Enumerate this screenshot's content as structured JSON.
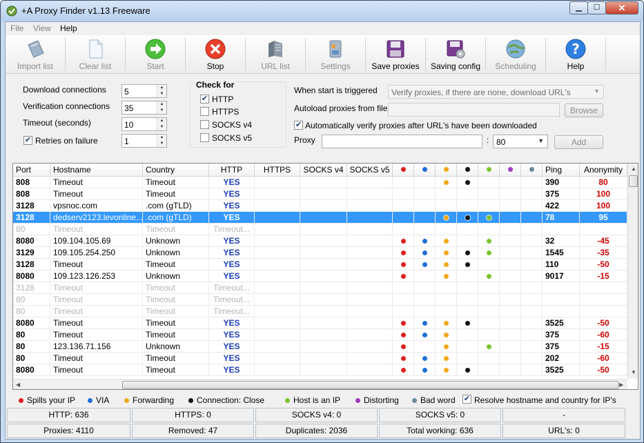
{
  "window": {
    "title": "+A Proxy Finder v1.13 Freeware"
  },
  "menu": [
    "File",
    "View",
    "Help"
  ],
  "toolbar": [
    {
      "label": "Import list",
      "icon": "import-list-icon",
      "enabled": false
    },
    {
      "label": "Clear list",
      "icon": "clear-list-icon",
      "enabled": false
    },
    {
      "label": "Start",
      "icon": "start-icon",
      "enabled": false
    },
    {
      "label": "Stop",
      "icon": "stop-icon",
      "enabled": true
    },
    {
      "label": "URL list",
      "icon": "url-list-icon",
      "enabled": false
    },
    {
      "label": "Settings",
      "icon": "settings-icon",
      "enabled": false
    },
    {
      "label": "Save proxies",
      "icon": "save-proxies-icon",
      "enabled": true
    },
    {
      "label": "Saving config",
      "icon": "saving-config-icon",
      "enabled": true
    },
    {
      "label": "Scheduling",
      "icon": "scheduling-icon",
      "enabled": false
    },
    {
      "label": "Help",
      "icon": "help-icon",
      "enabled": true
    }
  ],
  "options": {
    "download_label": "Download connections",
    "download_value": "5",
    "verify_label": "Verification connections",
    "verify_value": "35",
    "timeout_label": "Timeout (seconds)",
    "timeout_value": "10",
    "retries_label": "Retries on failure",
    "retries_value": "1",
    "retries_checked": true,
    "check_for_title": "Check for",
    "check_http": "HTTP",
    "check_https": "HTTPS",
    "check_socks4": "SOCKS v4",
    "check_socks5": "SOCKS v5",
    "trigger_label": "When start is triggered",
    "trigger_value": "Verify proxies, if there are none, download URL's",
    "autoload_label": "Autoload proxies from file",
    "browse_label": "Browse",
    "auto_verify_label": "Automatically verify proxies after URL's have been downloaded",
    "proxy_label": "Proxy",
    "port_sep": ":",
    "port_value": "80",
    "add_label": "Add"
  },
  "grid": {
    "headers": [
      "Port",
      "Hostname",
      "Country",
      "HTTP",
      "HTTPS",
      "SOCKS v4",
      "SOCKS v5",
      "",
      "",
      "",
      "",
      "",
      "",
      "",
      "Ping",
      "Anonymity"
    ],
    "flag_colors": [
      "#e02020",
      "#1e6fd9",
      "#f0a818",
      "#111111",
      "#7cc22c",
      "#a23ac0",
      "#6a8a99"
    ],
    "rows": [
      {
        "port": "808",
        "host": "Timeout",
        "country": "Timeout",
        "http": "YES",
        "flags": [
          0,
          0,
          1,
          1,
          0,
          0,
          0
        ],
        "ping": "390",
        "anon": "80",
        "style": "normal"
      },
      {
        "port": "808",
        "host": "Timeout",
        "country": "Timeout",
        "http": "YES",
        "flags": [
          0,
          0,
          0,
          0,
          0,
          0,
          0
        ],
        "ping": "375",
        "anon": "100",
        "style": "normal"
      },
      {
        "port": "3128",
        "host": "vpsnoc.com",
        "country": ".com (gTLD)",
        "http": "YES",
        "flags": [
          0,
          0,
          0,
          0,
          0,
          0,
          0
        ],
        "ping": "422",
        "anon": "100",
        "style": "normal"
      },
      {
        "port": "3128",
        "host": "dedserv2123.levonline...",
        "country": ".com (gTLD)",
        "http": "YES",
        "flags": [
          0,
          0,
          1,
          1,
          1,
          0,
          0
        ],
        "ping": "78",
        "anon": "95",
        "style": "sel"
      },
      {
        "port": "80",
        "host": "Timeout",
        "country": "Timeout",
        "http": "Timeout...",
        "flags": [
          0,
          0,
          0,
          0,
          0,
          0,
          0
        ],
        "ping": "",
        "anon": "",
        "style": "gray"
      },
      {
        "port": "8080",
        "host": "109.104.105.69",
        "country": "Unknown",
        "http": "YES",
        "flags": [
          1,
          1,
          1,
          0,
          1,
          0,
          0
        ],
        "ping": "32",
        "anon": "-45",
        "style": "normal"
      },
      {
        "port": "3129",
        "host": "109.105.254.250",
        "country": "Unknown",
        "http": "YES",
        "flags": [
          1,
          1,
          1,
          1,
          1,
          0,
          0
        ],
        "ping": "1545",
        "anon": "-35",
        "style": "normal"
      },
      {
        "port": "3128",
        "host": "Timeout",
        "country": "Timeout",
        "http": "YES",
        "flags": [
          1,
          1,
          1,
          1,
          0,
          0,
          0
        ],
        "ping": "110",
        "anon": "-50",
        "style": "normal"
      },
      {
        "port": "8080",
        "host": "109.123.126.253",
        "country": "Unknown",
        "http": "YES",
        "flags": [
          1,
          0,
          1,
          0,
          1,
          0,
          0
        ],
        "ping": "9017",
        "anon": "-15",
        "style": "normal"
      },
      {
        "port": "3128",
        "host": "Timeout",
        "country": "Timeout",
        "http": "Timeout...",
        "flags": [
          0,
          0,
          0,
          0,
          0,
          0,
          0
        ],
        "ping": "",
        "anon": "",
        "style": "gray"
      },
      {
        "port": "80",
        "host": "Timeout",
        "country": "Timeout",
        "http": "Timeout...",
        "flags": [
          0,
          0,
          0,
          0,
          0,
          0,
          0
        ],
        "ping": "",
        "anon": "",
        "style": "gray"
      },
      {
        "port": "80",
        "host": "Timeout",
        "country": "Timeout",
        "http": "Timeout...",
        "flags": [
          0,
          0,
          0,
          0,
          0,
          0,
          0
        ],
        "ping": "",
        "anon": "",
        "style": "gray"
      },
      {
        "port": "8080",
        "host": "Timeout",
        "country": "Timeout",
        "http": "YES",
        "flags": [
          1,
          1,
          1,
          1,
          0,
          0,
          0
        ],
        "ping": "3525",
        "anon": "-50",
        "style": "normal"
      },
      {
        "port": "80",
        "host": "Timeout",
        "country": "Timeout",
        "http": "YES",
        "flags": [
          1,
          1,
          1,
          0,
          0,
          0,
          0
        ],
        "ping": "375",
        "anon": "-60",
        "style": "normal"
      },
      {
        "port": "80",
        "host": "123.136.71.156",
        "country": "Unknown",
        "http": "YES",
        "flags": [
          1,
          0,
          1,
          0,
          1,
          0,
          0
        ],
        "ping": "375",
        "anon": "-15",
        "style": "normal"
      },
      {
        "port": "80",
        "host": "Timeout",
        "country": "Timeout",
        "http": "YES",
        "flags": [
          1,
          1,
          1,
          0,
          0,
          0,
          0
        ],
        "ping": "202",
        "anon": "-60",
        "style": "normal"
      },
      {
        "port": "8080",
        "host": "Timeout",
        "country": "Timeout",
        "http": "YES",
        "flags": [
          1,
          1,
          1,
          1,
          0,
          0,
          0
        ],
        "ping": "3525",
        "anon": "-50",
        "style": "normal"
      }
    ]
  },
  "legend": {
    "items": [
      "Spills your IP",
      "VIA",
      "Forwarding",
      "Connection: Close",
      "Host is an IP",
      "Distorting",
      "Bad word"
    ],
    "resolve_label": "Resolve hostname and country for IP's"
  },
  "status": {
    "row1": [
      "HTTP: 636",
      "HTTPS: 0",
      "SOCKS v4: 0",
      "SOCKS v5: 0",
      "-"
    ],
    "row2": [
      "Proxies: 4110",
      "Removed: 47",
      "Duplicates: 2036",
      "Total working: 636",
      "URL's: 0"
    ]
  }
}
